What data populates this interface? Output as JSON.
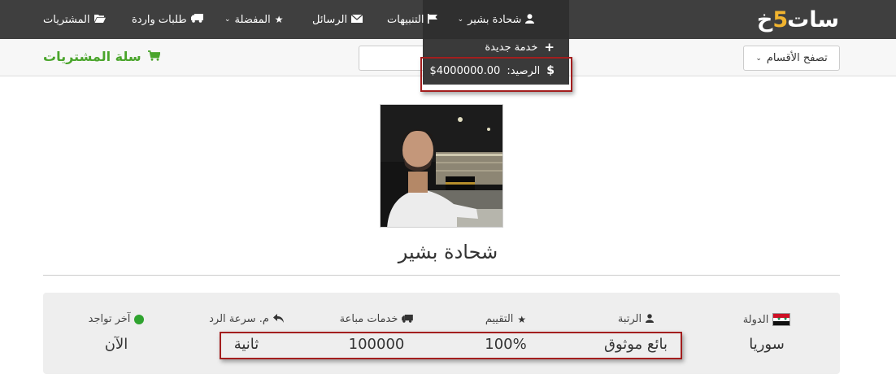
{
  "brand": {
    "logo_prefix": "خ",
    "logo_digit": "5",
    "logo_suffix": "سات"
  },
  "nav": {
    "user": "شحادة بشير",
    "notifications": "التنبيهات",
    "messages": "الرسائل",
    "favorites": "المفضلة",
    "incoming_requests": "طلبات واردة",
    "purchases": "المشتريات"
  },
  "dropdown": {
    "new_service": "خدمة جديدة",
    "balance_label": "الرصيد:",
    "balance_value": "$4000000.00"
  },
  "subbar": {
    "browse_categories": "تصفح الأقسام",
    "search_value": "",
    "cart": "سلة المشتريات"
  },
  "profile": {
    "name": "شحادة بشير"
  },
  "stats": {
    "country_label": "الدولة",
    "country_value": "سوريا",
    "rank_label": "الرتبة",
    "rank_value": "بائع موثوق",
    "rating_label": "التقييم",
    "rating_value": "100%",
    "sold_label": "خدمات مباعة",
    "sold_value": "100000",
    "response_label": "م. سرعة الرد",
    "response_value": "ثانية",
    "last_seen_label": "آخر تواجد",
    "last_seen_value": "الآن"
  },
  "colors": {
    "navbar": "#3f3f3f",
    "accent_green": "#4aa52c",
    "highlight_red": "#a31e1e",
    "logo_gold": "#f1b42f"
  },
  "icons": {
    "user": "user-icon",
    "notifications": "flag-icon",
    "messages": "envelope-icon",
    "favorites": "star-icon",
    "incoming": "truck-icon",
    "purchases": "folder-open-icon",
    "new_service": "plus-icon",
    "balance": "dollar-icon",
    "cart": "shopping-cart-icon",
    "rating": "star-icon",
    "sold": "truck-icon",
    "response": "reply-icon",
    "online": "online-dot"
  }
}
